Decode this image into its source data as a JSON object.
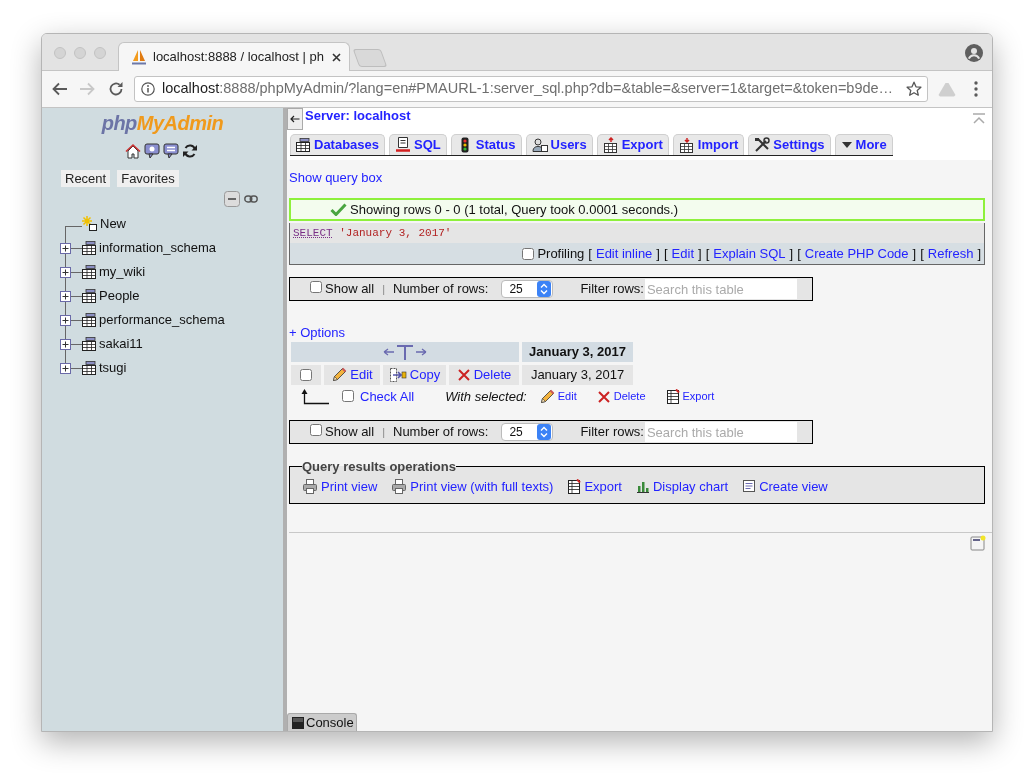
{
  "browser": {
    "tab": {
      "title": "localhost:8888 / localhost | ph"
    },
    "forward": {
      "disabled": true
    },
    "address": {
      "host": "localhost",
      "rest": ":8888/phpMyAdmin/?lang=en#PMAURL-1:server_sql.php?db=&table=&server=1&target=&token=b9de…"
    }
  },
  "sidebar": {
    "logo": [
      "php",
      "MyAdmin"
    ],
    "buttons": [
      "Recent",
      "Favorites"
    ],
    "tree": [
      {
        "kind": "new",
        "label": "New"
      },
      {
        "kind": "database",
        "label": "information_schema",
        "expanded": false
      },
      {
        "kind": "database",
        "label": "my_wiki",
        "expanded": false
      },
      {
        "kind": "database",
        "label": "People",
        "expanded": false
      },
      {
        "kind": "database",
        "label": "performance_schema",
        "expanded": false
      },
      {
        "kind": "database",
        "label": "sakai11",
        "expanded": false
      },
      {
        "kind": "database",
        "label": "tsugi",
        "expanded": false
      }
    ]
  },
  "header": {
    "server": "Server: localhost"
  },
  "tabs": [
    {
      "kind": "databases",
      "label": "Databases",
      "selected": false
    },
    {
      "kind": "sql",
      "label": "SQL",
      "selected": false
    },
    {
      "kind": "status",
      "label": "Status",
      "selected": false
    },
    {
      "kind": "users",
      "label": "Users",
      "selected": false
    },
    {
      "kind": "export",
      "label": "Export",
      "selected": false
    },
    {
      "kind": "import",
      "label": "Import",
      "selected": false
    },
    {
      "kind": "settings",
      "label": "Settings",
      "selected": false
    },
    {
      "kind": "more",
      "label": "More",
      "selected": false
    }
  ],
  "show_query_box": "Show query box",
  "message": {
    "text": "Showing rows 0 - 0 (1 total, Query took 0.0001 seconds.)"
  },
  "sql": {
    "keyword": "SELECT",
    "literal": "'January 3, 2017'",
    "profiling": {
      "label": "Profiling",
      "checked": false
    },
    "links": [
      {
        "open": "[",
        "label": "Edit inline",
        "close": "]"
      },
      {
        "open": "[",
        "label": "Edit",
        "close": "]"
      },
      {
        "open": "[",
        "label": "Explain SQL",
        "close": "]"
      },
      {
        "open": "[",
        "label": "Create PHP Code",
        "close": "]"
      },
      {
        "open": "[",
        "label": "Refresh",
        "close": "]"
      }
    ]
  },
  "navigation": [
    {
      "show_all": {
        "label": "Show all",
        "checked": false
      },
      "separator": "|",
      "rows_label": "Number of rows:",
      "rows_value": "25",
      "filter_label": "Filter rows:",
      "filter": {
        "placeholder": "Search this table"
      }
    },
    {
      "show_all": {
        "label": "Show all",
        "checked": false
      },
      "separator": "|",
      "rows_label": "Number of rows:",
      "rows_value": "25",
      "filter_label": "Filter rows:",
      "filter": {
        "placeholder": "Search this table"
      }
    }
  ],
  "options": "+ Options",
  "results": {
    "columns": [
      "January 3, 2017"
    ],
    "rows": [
      {
        "checked": false,
        "actions": [
          {
            "kind": "edit",
            "label": "Edit"
          },
          {
            "kind": "copy",
            "label": "Copy"
          },
          {
            "kind": "delete",
            "label": "Delete"
          }
        ],
        "cells": [
          "January 3, 2017"
        ]
      }
    ]
  },
  "bulk": {
    "check_all": {
      "label": "Check All",
      "checked": false
    },
    "with_selected": "With selected:",
    "actions": [
      {
        "kind": "edit",
        "label": "Edit"
      },
      {
        "kind": "delete",
        "label": "Delete"
      },
      {
        "kind": "export",
        "label": "Export"
      }
    ]
  },
  "operations": {
    "legend": "Query results operations",
    "links": [
      {
        "kind": "print",
        "label": "Print view"
      },
      {
        "kind": "print",
        "label": "Print view (with full texts)"
      },
      {
        "kind": "export",
        "label": "Export"
      },
      {
        "kind": "chart",
        "label": "Display chart"
      },
      {
        "kind": "view",
        "label": "Create view"
      }
    ]
  },
  "console": {
    "label": "Console"
  }
}
